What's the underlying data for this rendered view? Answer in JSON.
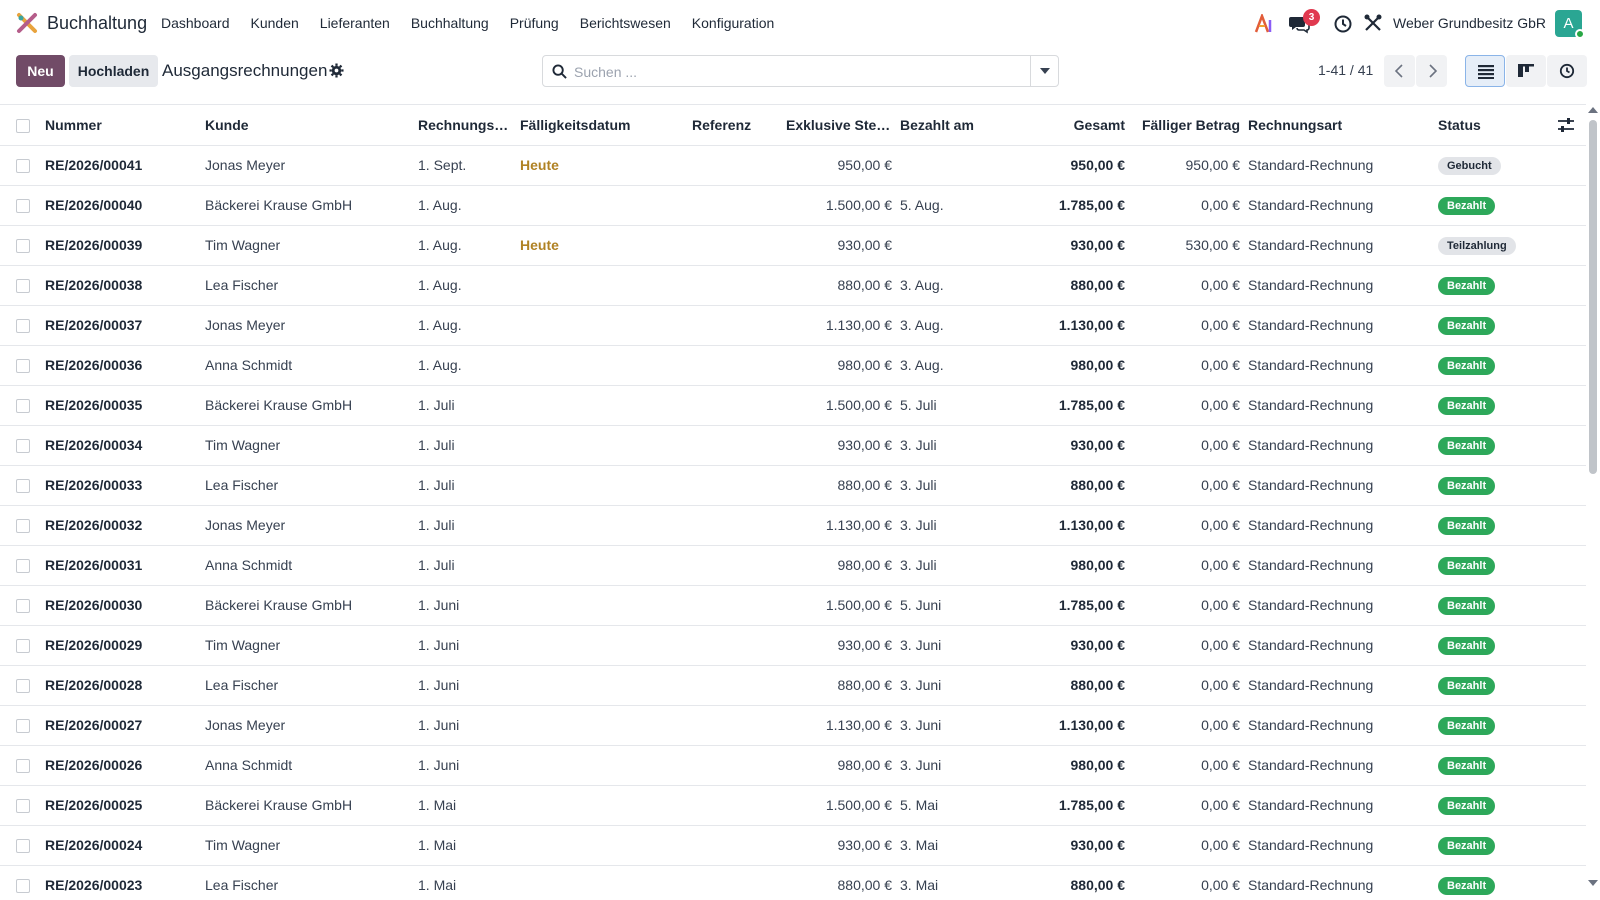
{
  "navbar": {
    "app_name": "Buchhaltung",
    "menu": [
      "Dashboard",
      "Kunden",
      "Lieferanten",
      "Buchhaltung",
      "Prüfung",
      "Berichtswesen",
      "Konfiguration"
    ],
    "chat_badge": "3",
    "company": "Weber Grundbesitz GbR",
    "avatar_initial": "A"
  },
  "control": {
    "new_label": "Neu",
    "upload_label": "Hochladen",
    "title": "Ausgangsrechnungen",
    "search_placeholder": "Suchen ...",
    "pager": "1-41 / 41"
  },
  "table": {
    "columns": [
      "Nummer",
      "Kunde",
      "Rechnungsd...",
      "Fälligkeitsdatum",
      "Referenz",
      "Exklusive Steu...",
      "Bezahlt am",
      "Gesamt",
      "Fälliger Betrag",
      "Rechnungsart",
      "Status"
    ],
    "rows": [
      {
        "number": "RE/2026/00041",
        "customer": "Jonas Meyer",
        "invoice_date": "1. Sept.",
        "due_date": "Heute",
        "reference": "",
        "untaxed": "950,00 €",
        "paid_on": "",
        "total": "950,00 €",
        "amount_due": "950,00 €",
        "type": "Standard-Rechnung",
        "status": "Gebucht",
        "status_kind": "posted"
      },
      {
        "number": "RE/2026/00040",
        "customer": "Bäckerei Krause GmbH",
        "invoice_date": "1. Aug.",
        "due_date": "",
        "reference": "",
        "untaxed": "1.500,00 €",
        "paid_on": "5. Aug.",
        "total": "1.785,00 €",
        "amount_due": "0,00 €",
        "type": "Standard-Rechnung",
        "status": "Bezahlt",
        "status_kind": "paid"
      },
      {
        "number": "RE/2026/00039",
        "customer": "Tim Wagner",
        "invoice_date": "1. Aug.",
        "due_date": "Heute",
        "reference": "",
        "untaxed": "930,00 €",
        "paid_on": "",
        "total": "930,00 €",
        "amount_due": "530,00 €",
        "type": "Standard-Rechnung",
        "status": "Teilzahlung",
        "status_kind": "partial"
      },
      {
        "number": "RE/2026/00038",
        "customer": "Lea Fischer",
        "invoice_date": "1. Aug.",
        "due_date": "",
        "reference": "",
        "untaxed": "880,00 €",
        "paid_on": "3. Aug.",
        "total": "880,00 €",
        "amount_due": "0,00 €",
        "type": "Standard-Rechnung",
        "status": "Bezahlt",
        "status_kind": "paid"
      },
      {
        "number": "RE/2026/00037",
        "customer": "Jonas Meyer",
        "invoice_date": "1. Aug.",
        "due_date": "",
        "reference": "",
        "untaxed": "1.130,00 €",
        "paid_on": "3. Aug.",
        "total": "1.130,00 €",
        "amount_due": "0,00 €",
        "type": "Standard-Rechnung",
        "status": "Bezahlt",
        "status_kind": "paid"
      },
      {
        "number": "RE/2026/00036",
        "customer": "Anna Schmidt",
        "invoice_date": "1. Aug.",
        "due_date": "",
        "reference": "",
        "untaxed": "980,00 €",
        "paid_on": "3. Aug.",
        "total": "980,00 €",
        "amount_due": "0,00 €",
        "type": "Standard-Rechnung",
        "status": "Bezahlt",
        "status_kind": "paid"
      },
      {
        "number": "RE/2026/00035",
        "customer": "Bäckerei Krause GmbH",
        "invoice_date": "1. Juli",
        "due_date": "",
        "reference": "",
        "untaxed": "1.500,00 €",
        "paid_on": "5. Juli",
        "total": "1.785,00 €",
        "amount_due": "0,00 €",
        "type": "Standard-Rechnung",
        "status": "Bezahlt",
        "status_kind": "paid"
      },
      {
        "number": "RE/2026/00034",
        "customer": "Tim Wagner",
        "invoice_date": "1. Juli",
        "due_date": "",
        "reference": "",
        "untaxed": "930,00 €",
        "paid_on": "3. Juli",
        "total": "930,00 €",
        "amount_due": "0,00 €",
        "type": "Standard-Rechnung",
        "status": "Bezahlt",
        "status_kind": "paid"
      },
      {
        "number": "RE/2026/00033",
        "customer": "Lea Fischer",
        "invoice_date": "1. Juli",
        "due_date": "",
        "reference": "",
        "untaxed": "880,00 €",
        "paid_on": "3. Juli",
        "total": "880,00 €",
        "amount_due": "0,00 €",
        "type": "Standard-Rechnung",
        "status": "Bezahlt",
        "status_kind": "paid"
      },
      {
        "number": "RE/2026/00032",
        "customer": "Jonas Meyer",
        "invoice_date": "1. Juli",
        "due_date": "",
        "reference": "",
        "untaxed": "1.130,00 €",
        "paid_on": "3. Juli",
        "total": "1.130,00 €",
        "amount_due": "0,00 €",
        "type": "Standard-Rechnung",
        "status": "Bezahlt",
        "status_kind": "paid"
      },
      {
        "number": "RE/2026/00031",
        "customer": "Anna Schmidt",
        "invoice_date": "1. Juli",
        "due_date": "",
        "reference": "",
        "untaxed": "980,00 €",
        "paid_on": "3. Juli",
        "total": "980,00 €",
        "amount_due": "0,00 €",
        "type": "Standard-Rechnung",
        "status": "Bezahlt",
        "status_kind": "paid"
      },
      {
        "number": "RE/2026/00030",
        "customer": "Bäckerei Krause GmbH",
        "invoice_date": "1. Juni",
        "due_date": "",
        "reference": "",
        "untaxed": "1.500,00 €",
        "paid_on": "5. Juni",
        "total": "1.785,00 €",
        "amount_due": "0,00 €",
        "type": "Standard-Rechnung",
        "status": "Bezahlt",
        "status_kind": "paid"
      },
      {
        "number": "RE/2026/00029",
        "customer": "Tim Wagner",
        "invoice_date": "1. Juni",
        "due_date": "",
        "reference": "",
        "untaxed": "930,00 €",
        "paid_on": "3. Juni",
        "total": "930,00 €",
        "amount_due": "0,00 €",
        "type": "Standard-Rechnung",
        "status": "Bezahlt",
        "status_kind": "paid"
      },
      {
        "number": "RE/2026/00028",
        "customer": "Lea Fischer",
        "invoice_date": "1. Juni",
        "due_date": "",
        "reference": "",
        "untaxed": "880,00 €",
        "paid_on": "3. Juni",
        "total": "880,00 €",
        "amount_due": "0,00 €",
        "type": "Standard-Rechnung",
        "status": "Bezahlt",
        "status_kind": "paid"
      },
      {
        "number": "RE/2026/00027",
        "customer": "Jonas Meyer",
        "invoice_date": "1. Juni",
        "due_date": "",
        "reference": "",
        "untaxed": "1.130,00 €",
        "paid_on": "3. Juni",
        "total": "1.130,00 €",
        "amount_due": "0,00 €",
        "type": "Standard-Rechnung",
        "status": "Bezahlt",
        "status_kind": "paid"
      },
      {
        "number": "RE/2026/00026",
        "customer": "Anna Schmidt",
        "invoice_date": "1. Juni",
        "due_date": "",
        "reference": "",
        "untaxed": "980,00 €",
        "paid_on": "3. Juni",
        "total": "980,00 €",
        "amount_due": "0,00 €",
        "type": "Standard-Rechnung",
        "status": "Bezahlt",
        "status_kind": "paid"
      },
      {
        "number": "RE/2026/00025",
        "customer": "Bäckerei Krause GmbH",
        "invoice_date": "1. Mai",
        "due_date": "",
        "reference": "",
        "untaxed": "1.500,00 €",
        "paid_on": "5. Mai",
        "total": "1.785,00 €",
        "amount_due": "0,00 €",
        "type": "Standard-Rechnung",
        "status": "Bezahlt",
        "status_kind": "paid"
      },
      {
        "number": "RE/2026/00024",
        "customer": "Tim Wagner",
        "invoice_date": "1. Mai",
        "due_date": "",
        "reference": "",
        "untaxed": "930,00 €",
        "paid_on": "3. Mai",
        "total": "930,00 €",
        "amount_due": "0,00 €",
        "type": "Standard-Rechnung",
        "status": "Bezahlt",
        "status_kind": "paid"
      },
      {
        "number": "RE/2026/00023",
        "customer": "Lea Fischer",
        "invoice_date": "1. Mai",
        "due_date": "",
        "reference": "",
        "untaxed": "880,00 €",
        "paid_on": "3. Mai",
        "total": "880,00 €",
        "amount_due": "0,00 €",
        "type": "Standard-Rechnung",
        "status": "Bezahlt",
        "status_kind": "paid"
      }
    ]
  }
}
